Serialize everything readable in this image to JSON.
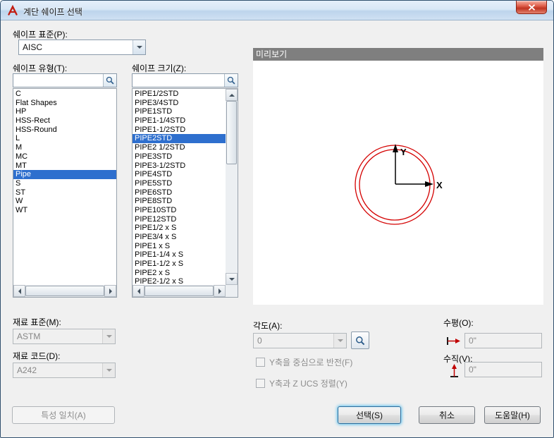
{
  "window": {
    "title": "계단 쉐이프 선택"
  },
  "shape_standard": {
    "label": "쉐이프 표준(P):",
    "value": "AISC"
  },
  "shape_type": {
    "label": "쉐이프 유형(T):",
    "filter_value": "",
    "selected": "Pipe",
    "items": [
      "C",
      "Flat Shapes",
      "HP",
      "HSS-Rect",
      "HSS-Round",
      "L",
      "M",
      "MC",
      "MT",
      "Pipe",
      "S",
      "ST",
      "W",
      "WT"
    ]
  },
  "shape_size": {
    "label": "쉐이프 크기(Z):",
    "filter_value": "",
    "selected": "PIPE2STD",
    "items": [
      "PIPE1/2STD",
      "PIPE3/4STD",
      "PIPE1STD",
      "PIPE1-1/4STD",
      "PIPE1-1/2STD",
      "PIPE2STD",
      "PIPE2 1/2STD",
      "PIPE3STD",
      "PIPE3-1/2STD",
      "PIPE4STD",
      "PIPE5STD",
      "PIPE6STD",
      "PIPE8STD",
      "PIPE10STD",
      "PIPE12STD",
      "PIPE1/2 x S",
      "PIPE3/4 x S",
      "PIPE1 x S",
      "PIPE1-1/4 x S",
      "PIPE1-1/2 x S",
      "PIPE2 x S",
      "PIPE2-1/2 x S"
    ]
  },
  "preview": {
    "label": "미리보기",
    "axis_x": "X",
    "axis_y": "Y"
  },
  "material_standard": {
    "label": "재료 표준(M):",
    "value": "ASTM"
  },
  "material_code": {
    "label": "재료 코드(D):",
    "value": "A242"
  },
  "angle": {
    "label": "각도(A):",
    "value": "0"
  },
  "options": {
    "flip_y": "Y축을 중심으로 반전(F)",
    "align_z_ucs": "Y축과 Z UCS 정렬(Y)"
  },
  "horizontal": {
    "label": "수평(O):",
    "value": "0\""
  },
  "vertical": {
    "label": "수직(V):",
    "value": "0\""
  },
  "buttons": {
    "match_properties": "특성 일치(A)",
    "select": "선택(S)",
    "cancel": "취소",
    "help": "도움말(H)"
  },
  "colors": {
    "selection": "#2e6fce",
    "preview_header": "#7f7f7f",
    "shape_outline": "#d40000"
  }
}
